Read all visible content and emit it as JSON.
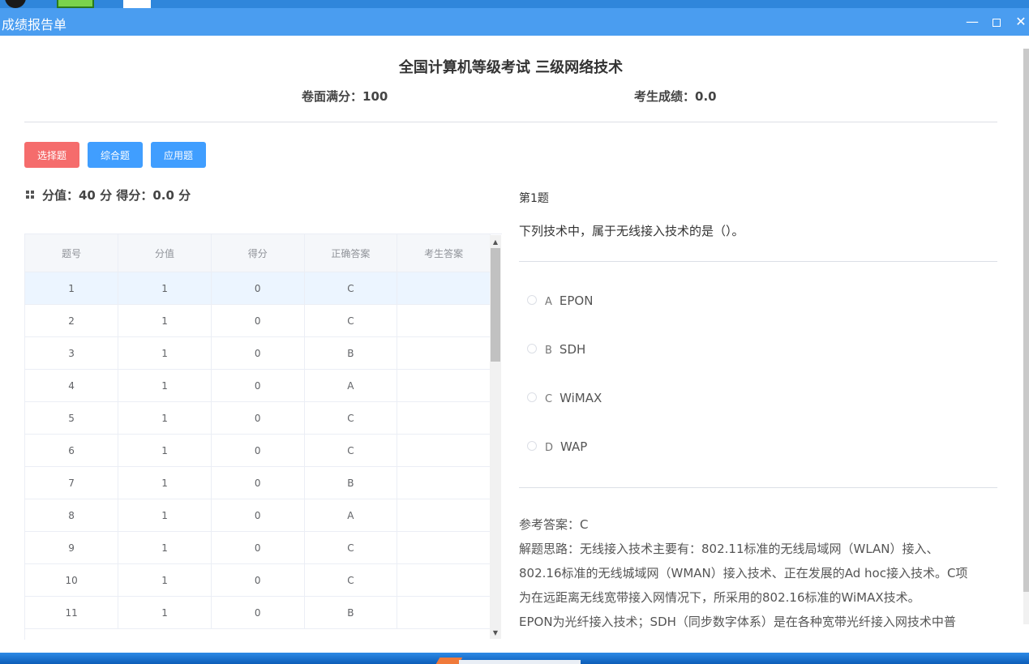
{
  "window": {
    "title": "成绩报告单",
    "min_glyph": "—",
    "close_glyph": "✕"
  },
  "header": {
    "exam_title": "全国计算机等级考试 三级网络技术",
    "full_score": "卷面满分：100",
    "student_score": "考生成绩：0.0"
  },
  "tabs": [
    {
      "label": "选择题",
      "color": "#f56c6c",
      "active": true
    },
    {
      "label": "综合题",
      "color": "#409eff"
    },
    {
      "label": "应用题",
      "color": "#409eff"
    }
  ],
  "section": {
    "score_text": "分值：40 分 得分：0.0 分"
  },
  "table": {
    "columns": [
      "题号",
      "分值",
      "得分",
      "正确答案",
      "考生答案"
    ],
    "rows": [
      [
        "1",
        "1",
        "0",
        "C",
        ""
      ],
      [
        "2",
        "1",
        "0",
        "C",
        ""
      ],
      [
        "3",
        "1",
        "0",
        "B",
        ""
      ],
      [
        "4",
        "1",
        "0",
        "A",
        ""
      ],
      [
        "5",
        "1",
        "0",
        "C",
        ""
      ],
      [
        "6",
        "1",
        "0",
        "C",
        ""
      ],
      [
        "7",
        "1",
        "0",
        "B",
        ""
      ],
      [
        "8",
        "1",
        "0",
        "A",
        ""
      ],
      [
        "9",
        "1",
        "0",
        "C",
        ""
      ],
      [
        "10",
        "1",
        "0",
        "C",
        ""
      ],
      [
        "11",
        "1",
        "0",
        "B",
        ""
      ]
    ]
  },
  "question": {
    "number": "第1题",
    "text": "下列技术中，属于无线接入技术的是（）。",
    "options": [
      {
        "letter": "A",
        "text": "EPON"
      },
      {
        "letter": "B",
        "text": "SDH"
      },
      {
        "letter": "C",
        "text": "WiMAX"
      },
      {
        "letter": "D",
        "text": "WAP"
      }
    ],
    "answer": "参考答案：C",
    "analysis": [
      "解题思路：无线接入技术主要有：802.11标准的无线局域网（WLAN）接入、",
      "802.16标准的无线城域网（WMAN）接入技术、正在发展的Ad hoc接入技术。C项",
      "为在远距离无线宽带接入网情况下，所采用的802.16标准的WiMAX技术。",
      "EPON为光纤接入技术；SDH（同步数字体系）是在各种宽带光纤接入网技术中普"
    ]
  },
  "icons": {
    "section": "grid-icon",
    "scroll_up": "arrow-up-icon",
    "scroll_down": "arrow-down-icon"
  }
}
